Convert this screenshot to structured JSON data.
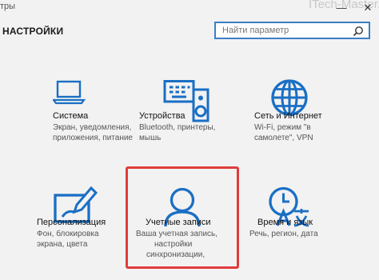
{
  "window": {
    "title_fragment": "тры",
    "watermark": "ITech-Master.ru"
  },
  "header": {
    "title": "НАСТРОЙКИ"
  },
  "search": {
    "placeholder": "Найти параметр"
  },
  "tiles": [
    {
      "name": "Система",
      "desc": [
        "Экран, уведомления,",
        "приложения, питание"
      ],
      "icon": "laptop-icon"
    },
    {
      "name": "Устройства",
      "desc": [
        "Bluetooth, принтеры,",
        "мышь"
      ],
      "icon": "devices-icon"
    },
    {
      "name": "Сеть и Интернет",
      "desc": [
        "Wi-Fi, режим \"в",
        "самолете\", VPN"
      ],
      "icon": "globe-icon"
    },
    {
      "name": "Персонализация",
      "desc": [
        "Фон, блокировка",
        "экрана, цвета"
      ],
      "icon": "paint-icon"
    },
    {
      "name": "Учетные записи",
      "desc": [
        "Ваша учетная запись,",
        "настройки",
        "синхронизации,"
      ],
      "icon": "person-icon"
    },
    {
      "name": "Время и язык",
      "desc": [
        "Речь, регион, дата"
      ],
      "icon": "time-language-icon"
    }
  ],
  "colors": {
    "accent": "#1a6fc4",
    "highlight": "#e03c3c",
    "background": "#f2f2f2"
  }
}
